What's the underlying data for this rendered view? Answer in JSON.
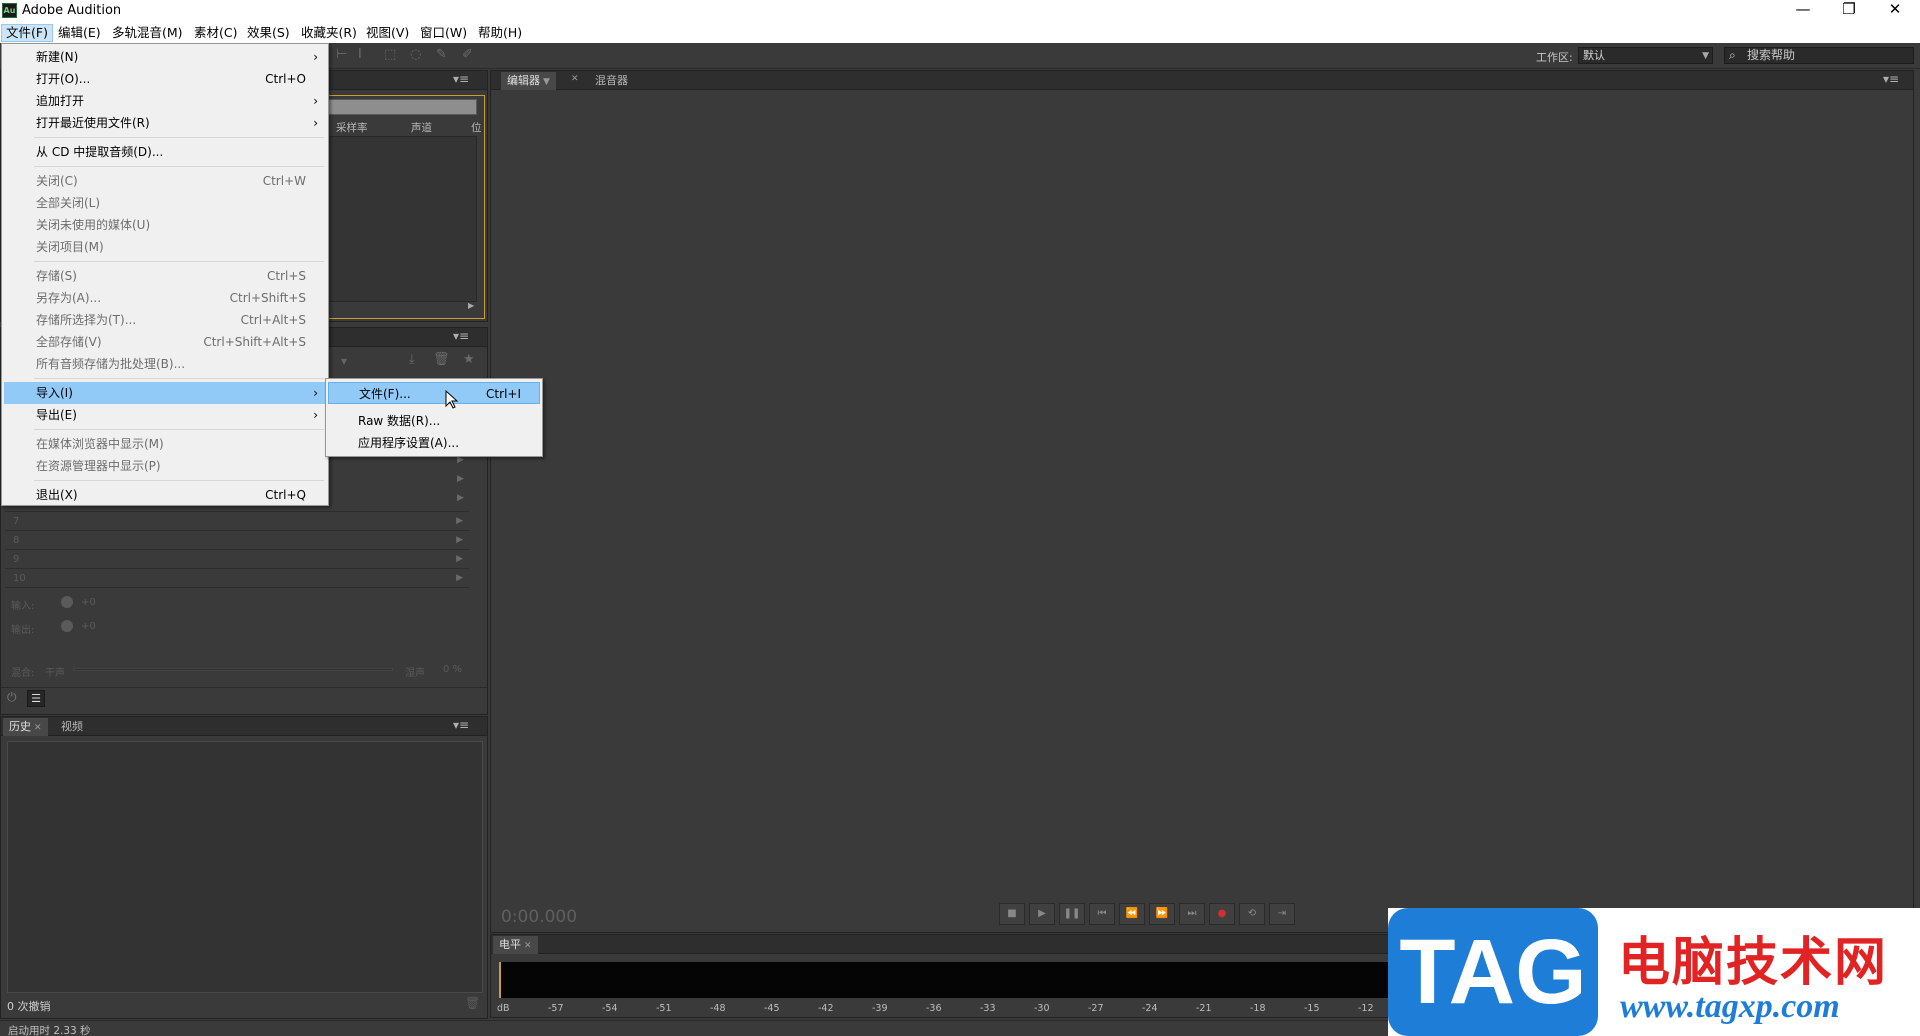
{
  "window": {
    "title": "Adobe Audition",
    "app_icon": "Au",
    "min": "—",
    "max": "❐",
    "close": "✕"
  },
  "menubar": [
    "文件(F)",
    "编辑(E)",
    "多轨混音(M)",
    "素材(C)",
    "效果(S)",
    "收藏夹(R)",
    "视图(V)",
    "窗口(W)",
    "帮助(H)"
  ],
  "toolbar": {
    "workspace_label": "工作区:",
    "workspace_value": "默认",
    "search_placeholder": "搜索帮助"
  },
  "files_panel": {
    "columns": [
      "采样率",
      "声道",
      "位"
    ]
  },
  "effects_rack": {
    "rows": [
      "7",
      "8",
      "9",
      "10"
    ],
    "input_label": "输入:",
    "input_value": "+0",
    "output_label": "输出:",
    "output_value": "+0",
    "mix_label": "混合:",
    "mix_dry": "干声",
    "mix_wet": "湿声",
    "mix_percent": "0 %"
  },
  "history_panel": {
    "tabs": [
      "历史",
      "视频"
    ],
    "undo_count": "0 次撤销"
  },
  "editor": {
    "tabs": [
      "编辑器",
      "混音器"
    ],
    "timecode": "0:00.000"
  },
  "level_meter": {
    "tab": "电平",
    "scale": [
      "dB",
      "-57",
      "-54",
      "-51",
      "-48",
      "-45",
      "-42",
      "-39",
      "-36",
      "-33",
      "-30",
      "-27",
      "-24",
      "-21",
      "-18",
      "-15",
      "-12"
    ]
  },
  "status": {
    "text": "启动用时 2.33 秒"
  },
  "file_menu": {
    "new": {
      "label": "新建(N)",
      "has_sub": true
    },
    "open": {
      "label": "打开(O)...",
      "shortcut": "Ctrl+O"
    },
    "append_open": {
      "label": "追加打开",
      "has_sub": true
    },
    "open_recent": {
      "label": "打开最近使用文件(R)",
      "has_sub": true
    },
    "extract_cd": {
      "label": "从 CD 中提取音频(D)..."
    },
    "close": {
      "label": "关闭(C)",
      "shortcut": "Ctrl+W"
    },
    "close_all": {
      "label": "全部关闭(L)"
    },
    "close_unused": {
      "label": "关闭未使用的媒体(U)"
    },
    "close_session": {
      "label": "关闭项目(M)"
    },
    "save": {
      "label": "存储(S)",
      "shortcut": "Ctrl+S"
    },
    "save_as": {
      "label": "另存为(A)...",
      "shortcut": "Ctrl+Shift+S"
    },
    "save_selection": {
      "label": "存储所选择为(T)...",
      "shortcut": "Ctrl+Alt+S"
    },
    "save_all": {
      "label": "全部存储(V)",
      "shortcut": "Ctrl+Shift+Alt+S"
    },
    "save_batch": {
      "label": "所有音频存储为批处理(B)..."
    },
    "import": {
      "label": "导入(I)"
    },
    "export": {
      "label": "导出(E)"
    },
    "reveal_media": {
      "label": "在媒体浏览器中显示(M)"
    },
    "reveal_explorer": {
      "label": "在资源管理器中显示(P)"
    },
    "exit": {
      "label": "退出(X)",
      "shortcut": "Ctrl+Q"
    },
    "submenu_arrow": "›"
  },
  "import_submenu": {
    "file": {
      "label": "文件(F)...",
      "shortcut": "Ctrl+I"
    },
    "raw": {
      "label": "Raw 数据(R)..."
    },
    "app_settings": {
      "label": "应用程序设置(A)..."
    }
  },
  "watermark": {
    "tag": "TAG",
    "cn": "电脑技术网",
    "url": "www.tagxp.com"
  }
}
